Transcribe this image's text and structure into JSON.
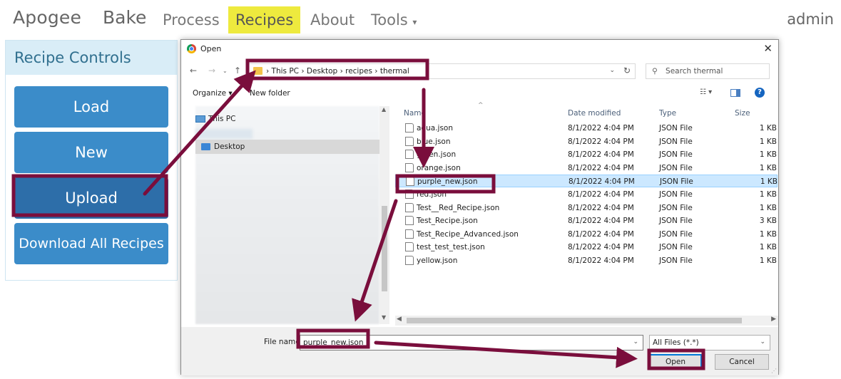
{
  "app": {
    "brand": "Apogee",
    "brand2": "Bake",
    "nav": [
      {
        "label": "Process"
      },
      {
        "label": "Recipes",
        "active": true
      },
      {
        "label": "About"
      },
      {
        "label": "Tools",
        "has_dropdown": true
      }
    ],
    "user": "admin"
  },
  "panel": {
    "title": "Recipe Controls",
    "buttons": {
      "load": "Load",
      "new": "New",
      "upload": "Upload",
      "download": "Download All Recipes"
    }
  },
  "dialog": {
    "title": "Open",
    "path": [
      "This PC",
      "Desktop",
      "recipes",
      "thermal"
    ],
    "search_placeholder": "Search thermal",
    "toolbar": {
      "organize": "Organize ▾",
      "new_folder": "New folder"
    },
    "tree": {
      "this_pc": "This PC",
      "desktop": "Desktop"
    },
    "columns": {
      "name": "Name",
      "date": "Date modified",
      "type": "Type",
      "size": "Size"
    },
    "files": [
      {
        "name": "aqua.json",
        "date": "8/1/2022 4:04 PM",
        "type": "JSON File",
        "size": "1 KB"
      },
      {
        "name": "blue.json",
        "date": "8/1/2022 4:04 PM",
        "type": "JSON File",
        "size": "1 KB"
      },
      {
        "name": "green.json",
        "date": "8/1/2022 4:04 PM",
        "type": "JSON File",
        "size": "1 KB"
      },
      {
        "name": "orange.json",
        "date": "8/1/2022 4:04 PM",
        "type": "JSON File",
        "size": "1 KB"
      },
      {
        "name": "purple_new.json",
        "date": "8/1/2022 4:04 PM",
        "type": "JSON File",
        "size": "1 KB",
        "selected": true
      },
      {
        "name": "red.json",
        "date": "8/1/2022 4:04 PM",
        "type": "JSON File",
        "size": "1 KB"
      },
      {
        "name": "Test__Red_Recipe.json",
        "date": "8/1/2022 4:04 PM",
        "type": "JSON File",
        "size": "1 KB"
      },
      {
        "name": "Test_Recipe.json",
        "date": "8/1/2022 4:04 PM",
        "type": "JSON File",
        "size": "3 KB"
      },
      {
        "name": "Test_Recipe_Advanced.json",
        "date": "8/1/2022 4:04 PM",
        "type": "JSON File",
        "size": "1 KB"
      },
      {
        "name": "test_test_test.json",
        "date": "8/1/2022 4:04 PM",
        "type": "JSON File",
        "size": "1 KB"
      },
      {
        "name": "yellow.json",
        "date": "8/1/2022 4:04 PM",
        "type": "JSON File",
        "size": "1 KB"
      }
    ],
    "file_name_label": "File name:",
    "file_name_value": "purple_new.json",
    "file_type": "All Files (*.*)",
    "open_label": "Open",
    "cancel_label": "Cancel"
  },
  "colors": {
    "active_nav": "#eeea3e",
    "button_blue": "#3b8cc9",
    "panel_head_bg": "#d9edf7",
    "annotation": "#7a0e3c",
    "selection": "#cce8ff"
  }
}
